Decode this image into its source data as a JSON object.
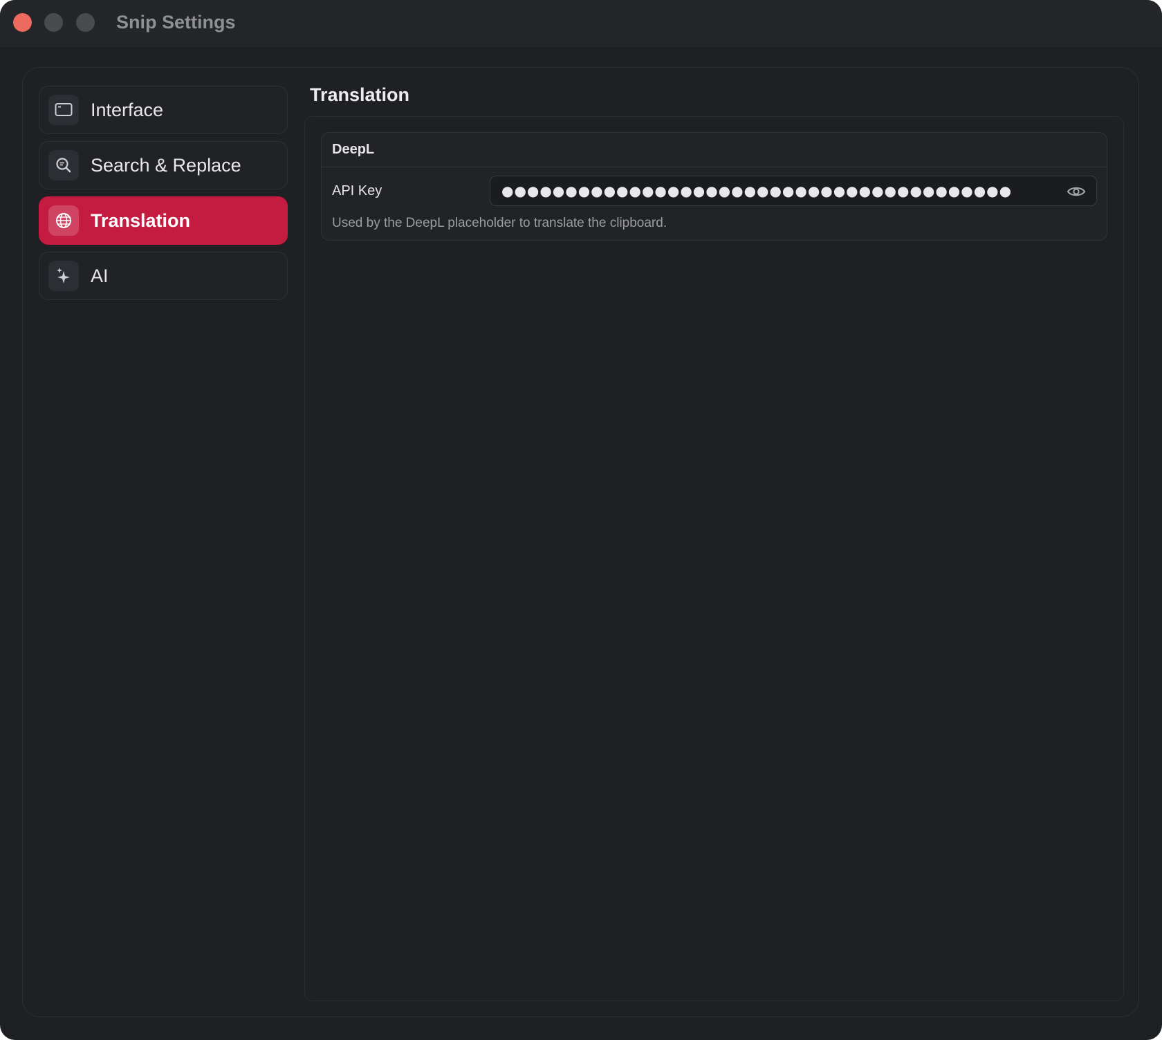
{
  "window": {
    "title": "Snip Settings"
  },
  "sidebar": {
    "items": [
      {
        "label": "Interface",
        "icon": "window-icon",
        "active": false
      },
      {
        "label": "Search & Replace",
        "icon": "magnifier-icon",
        "active": false
      },
      {
        "label": "Translation",
        "icon": "globe-icon",
        "active": true
      },
      {
        "label": "AI",
        "icon": "sparkle-icon",
        "active": false
      }
    ]
  },
  "main": {
    "title": "Translation",
    "sections": [
      {
        "title": "DeepL",
        "field_label": "API Key",
        "field_value": "●●●●●●●●●●●●●●●●●●●●●●●●●●●●●●●●●●●●●●●●",
        "help": "Used by the DeepL placeholder to translate the clipboard."
      }
    ]
  },
  "colors": {
    "accent": "#c41b40",
    "background": "#1f2023",
    "close_button": "#ec6a5e"
  }
}
